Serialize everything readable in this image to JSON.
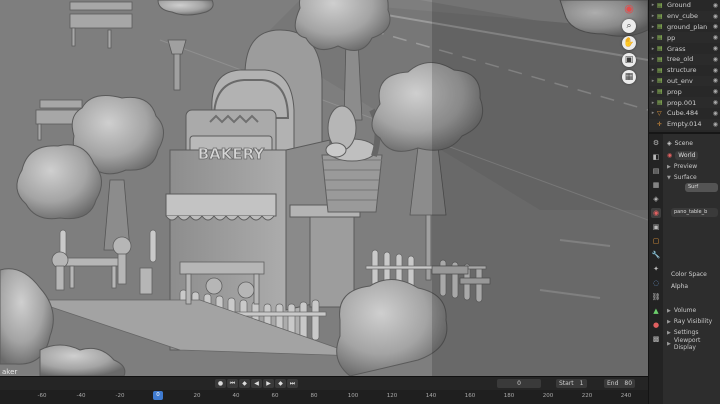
{
  "viewport": {
    "frame_label": "aker",
    "nav_tools": [
      "magnify-icon",
      "hand-icon",
      "camera-icon",
      "grid-icon"
    ],
    "sign_text": "BAKERY",
    "colors": {
      "background": "#7f7f7f",
      "clay": "#a8a8a8",
      "clay_shadow": "#6e6e6e",
      "ui_dark": "#282828",
      "accent": "#3f7bd1"
    }
  },
  "outliner": {
    "items": [
      {
        "label": "Ground",
        "icon": "collection-icon"
      },
      {
        "label": "env_cube",
        "icon": "collection-icon"
      },
      {
        "label": "ground_plan",
        "icon": "collection-icon"
      },
      {
        "label": "pp",
        "icon": "collection-icon"
      },
      {
        "label": "Grass",
        "icon": "collection-icon"
      },
      {
        "label": "tree_old",
        "icon": "collection-icon"
      },
      {
        "label": "structure",
        "icon": "collection-icon"
      },
      {
        "label": "out_env",
        "icon": "collection-icon"
      },
      {
        "label": "prop",
        "icon": "collection-icon"
      },
      {
        "label": "prop.001",
        "icon": "collection-icon"
      },
      {
        "label": "Cube.484",
        "icon": "mesh-icon"
      },
      {
        "label": "Empty.014",
        "icon": "empty-icon"
      }
    ]
  },
  "properties": {
    "scene_label": "Scene",
    "world_label": "World",
    "preview_label": "Preview",
    "surface_label": "Surface",
    "surface_value": "Surf",
    "texture_value": "pano_table_b",
    "color_space_label": "Color Space",
    "alpha_label": "Alpha",
    "volume_label": "Volume",
    "ray_visibility_label": "Ray Visibility",
    "settings_label": "Settings",
    "viewport_display_label": "Viewport Display"
  },
  "timeline": {
    "frame_value": "0",
    "start_label": "Start",
    "start_value": "1",
    "end_label": "End",
    "end_value": "80",
    "current_frame": "0",
    "ticks": [
      "-60",
      "-40",
      "-20",
      "20",
      "40",
      "60",
      "80",
      "100",
      "120",
      "140",
      "160",
      "180",
      "200",
      "220",
      "240"
    ]
  }
}
